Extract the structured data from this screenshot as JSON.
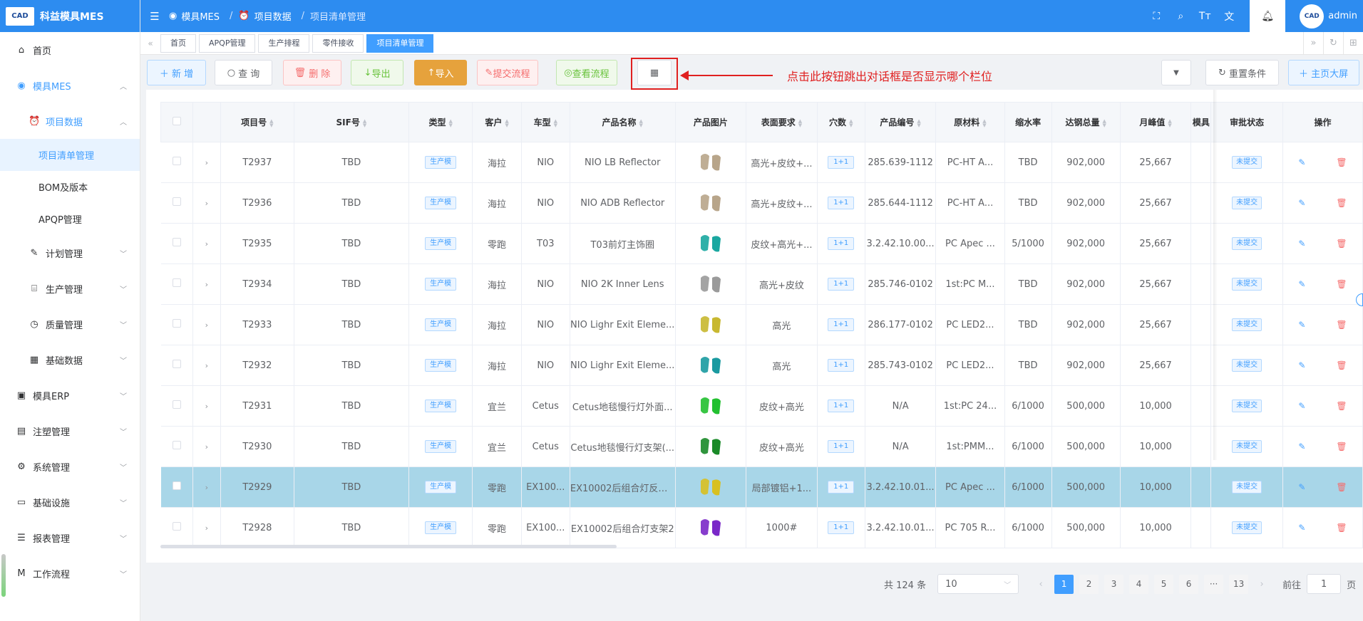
{
  "app": {
    "logo_text": "CAD",
    "title": "科益模具MES"
  },
  "sidebar": {
    "items": [
      {
        "label": "首页",
        "icon": "home-icon"
      },
      {
        "label": "模具MES",
        "icon": "camera-icon"
      },
      {
        "label": "项目数据",
        "icon": "alarm-clock-icon"
      },
      {
        "label": "项目清单管理"
      },
      {
        "label": "BOM及版本"
      },
      {
        "label": "APQP管理"
      },
      {
        "label": "计划管理",
        "icon": "edit-icon"
      },
      {
        "label": "生产管理",
        "icon": "factory-icon"
      },
      {
        "label": "质量管理",
        "icon": "timer-icon"
      },
      {
        "label": "基础数据",
        "icon": "calendar-icon"
      },
      {
        "label": "模具ERP",
        "icon": "box-icon"
      },
      {
        "label": "注塑管理",
        "icon": "suitcase-icon"
      },
      {
        "label": "系统管理",
        "icon": "gear-icon"
      },
      {
        "label": "基础设施",
        "icon": "monitor-icon"
      },
      {
        "label": "报表管理",
        "icon": "report-icon"
      },
      {
        "label": "工作流程",
        "icon": "workflow-icon"
      }
    ]
  },
  "header": {
    "breadcrumb": [
      "模具MES",
      "项目数据",
      "项目清单管理"
    ],
    "user": "admin",
    "avatar_text": "CAD"
  },
  "tabs": [
    "首页",
    "APQP管理",
    "生产排程",
    "零件接收",
    "项目清单管理"
  ],
  "toolbar": {
    "add": "新 增",
    "query": "查 询",
    "delete": "删 除",
    "export": "导出",
    "import": "导入",
    "submit_flow": "提交流程",
    "view_flow": "查看流程",
    "reset": "重置条件",
    "big_screen": "主页大屏",
    "annotation": "点击此按钮跳出对话框是否显示哪个栏位"
  },
  "table": {
    "columns": [
      "项目号",
      "SIF号",
      "类型",
      "客户",
      "车型",
      "产品名称",
      "产品图片",
      "表面要求",
      "穴数",
      "产品编号",
      "原材料",
      "缩水率",
      "达钢总量",
      "月峰值",
      "模具",
      "审批状态",
      "操作"
    ],
    "rows": [
      {
        "id": "T2937",
        "sif": "TBD",
        "type": "生产模",
        "customer": "海拉",
        "car": "NIO",
        "name": "NIO LB Reflector",
        "surface": "高光+皮纹+...",
        "cavity": "1+1",
        "code": "285.639-1112",
        "material": "PC-HT A...",
        "shrink": "TBD",
        "total": "902,000",
        "peak": "25,667",
        "status": "未提交",
        "img_color": "#b8a58a"
      },
      {
        "id": "T2936",
        "sif": "TBD",
        "type": "生产模",
        "customer": "海拉",
        "car": "NIO",
        "name": "NIO ADB Reflector",
        "surface": "高光+皮纹+...",
        "cavity": "1+1",
        "code": "285.644-1112",
        "material": "PC-HT A...",
        "shrink": "TBD",
        "total": "902,000",
        "peak": "25,667",
        "status": "未提交",
        "img_color": "#b8a58a"
      },
      {
        "id": "T2935",
        "sif": "TBD",
        "type": "生产模",
        "customer": "零跑",
        "car": "T03",
        "name": "T03前灯主饰圈",
        "surface": "皮纹+高光+...",
        "cavity": "1+1",
        "code": "3.2.42.10.00...",
        "material": "PC Apec ...",
        "shrink": "5/1000",
        "total": "902,000",
        "peak": "25,667",
        "status": "未提交",
        "img_color": "#1aa7a0"
      },
      {
        "id": "T2934",
        "sif": "TBD",
        "type": "生产模",
        "customer": "海拉",
        "car": "NIO",
        "name": "NIO 2K Inner Lens",
        "surface": "高光+皮纹",
        "cavity": "1+1",
        "code": "285.746-0102",
        "material": "1st:PC M...",
        "shrink": "TBD",
        "total": "902,000",
        "peak": "25,667",
        "status": "未提交",
        "img_color": "#9a9a9a"
      },
      {
        "id": "T2933",
        "sif": "TBD",
        "type": "生产模",
        "customer": "海拉",
        "car": "NIO",
        "name": "NIO Lighr Exit Eleme...",
        "surface": "高光",
        "cavity": "1+1",
        "code": "286.177-0102",
        "material": "PC LED2...",
        "shrink": "TBD",
        "total": "902,000",
        "peak": "25,667",
        "status": "未提交",
        "img_color": "#c8b830"
      },
      {
        "id": "T2932",
        "sif": "TBD",
        "type": "生产模",
        "customer": "海拉",
        "car": "NIO",
        "name": "NIO Lighr Exit Eleme...",
        "surface": "高光",
        "cavity": "1+1",
        "code": "285.743-0102",
        "material": "PC LED2...",
        "shrink": "TBD",
        "total": "902,000",
        "peak": "25,667",
        "status": "未提交",
        "img_color": "#1a9aa0"
      },
      {
        "id": "T2931",
        "sif": "TBD",
        "type": "生产模",
        "customer": "宜兰",
        "car": "Cetus",
        "name": "Cetus地毯慢行灯外面...",
        "surface": "皮纹+高光",
        "cavity": "1+1",
        "code": "N/A",
        "material": "1st:PC 24...",
        "shrink": "6/1000",
        "total": "500,000",
        "peak": "10,000",
        "status": "未提交",
        "img_color": "#22c030"
      },
      {
        "id": "T2930",
        "sif": "TBD",
        "type": "生产模",
        "customer": "宜兰",
        "car": "Cetus",
        "name": "Cetus地毯慢行灯支架(...",
        "surface": "皮纹+高光",
        "cavity": "1+1",
        "code": "N/A",
        "material": "1st:PMM...",
        "shrink": "6/1000",
        "total": "500,000",
        "peak": "10,000",
        "status": "未提交",
        "img_color": "#1a8a28"
      },
      {
        "id": "T2929",
        "sif": "TBD",
        "type": "生产模",
        "customer": "零跑",
        "car": "EX100...",
        "name": "EX10002后组合灯反射...",
        "surface": "局部镀铝+1...",
        "cavity": "1+1",
        "code": "3.2.42.10.01...",
        "material": "PC Apec ...",
        "shrink": "6/1000",
        "total": "500,000",
        "peak": "10,000",
        "status": "未提交",
        "img_color": "#d8c020"
      },
      {
        "id": "T2928",
        "sif": "TBD",
        "type": "生产模",
        "customer": "零跑",
        "car": "EX100...",
        "name": "EX10002后组合灯支架2",
        "surface": "1000#",
        "cavity": "1+1",
        "code": "3.2.42.10.01...",
        "material": "PC 705 R...",
        "shrink": "6/1000",
        "total": "500,000",
        "peak": "10,000",
        "status": "未提交",
        "img_color": "#7a28c8"
      }
    ]
  },
  "pagination": {
    "total": "共 124 条",
    "page_size": "10",
    "pages": [
      "1",
      "2",
      "3",
      "4",
      "5",
      "6",
      "···",
      "13"
    ],
    "current": "1",
    "goto_label": "前往",
    "goto_value": "1",
    "page_suffix": "页"
  },
  "colors": {
    "primary": "#2d8cf0",
    "accent": "#409eff",
    "danger": "#f56c6c",
    "success": "#67c23a",
    "warning": "#e6a23c",
    "annotation": "#e02020",
    "row_highlight": "#a8d6e8"
  }
}
